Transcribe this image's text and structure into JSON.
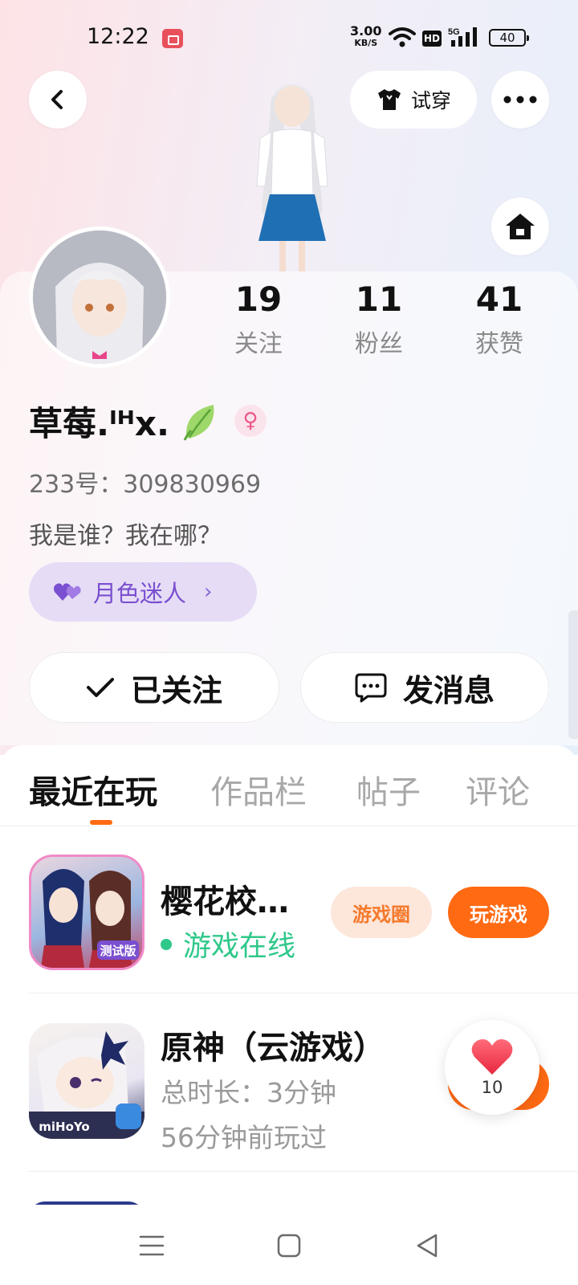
{
  "status_bar": {
    "time": "12:22",
    "net_speed": "3.00",
    "net_speed_unit": "KB/S",
    "hd": "HD",
    "network_type": "5G",
    "battery": "40"
  },
  "header": {
    "tryon_label": "试穿"
  },
  "profile": {
    "stats": [
      {
        "value": "19",
        "label": "关注"
      },
      {
        "value": "11",
        "label": "粉丝"
      },
      {
        "value": "41",
        "label": "获赞"
      }
    ],
    "nickname": "草莓.ᴵᴴx.",
    "uid": "233号：309830969",
    "bio": "我是谁？我在哪？",
    "tag": "月色迷人"
  },
  "actions": {
    "follow_label": "已关注",
    "message_label": "发消息"
  },
  "tabs": [
    {
      "label": "最近在玩",
      "active": true
    },
    {
      "label": "作品栏",
      "active": false
    },
    {
      "label": "帖子",
      "active": false
    },
    {
      "label": "评论",
      "active": false
    }
  ],
  "games": [
    {
      "title": "樱花校…",
      "status": "游戏在线",
      "circle_label": "游戏圈",
      "play_label": "玩游戏",
      "icon_badge": "测试版"
    },
    {
      "title": "原神（云游戏）",
      "duration": "总时长：3分钟",
      "last_played": "56分钟前玩过",
      "icon_badge": "miHoYo"
    }
  ],
  "like_float": {
    "count": "10"
  },
  "colors": {
    "accent": "#ff6a13",
    "online": "#2fc88a",
    "tag": "#7a4fd0"
  }
}
